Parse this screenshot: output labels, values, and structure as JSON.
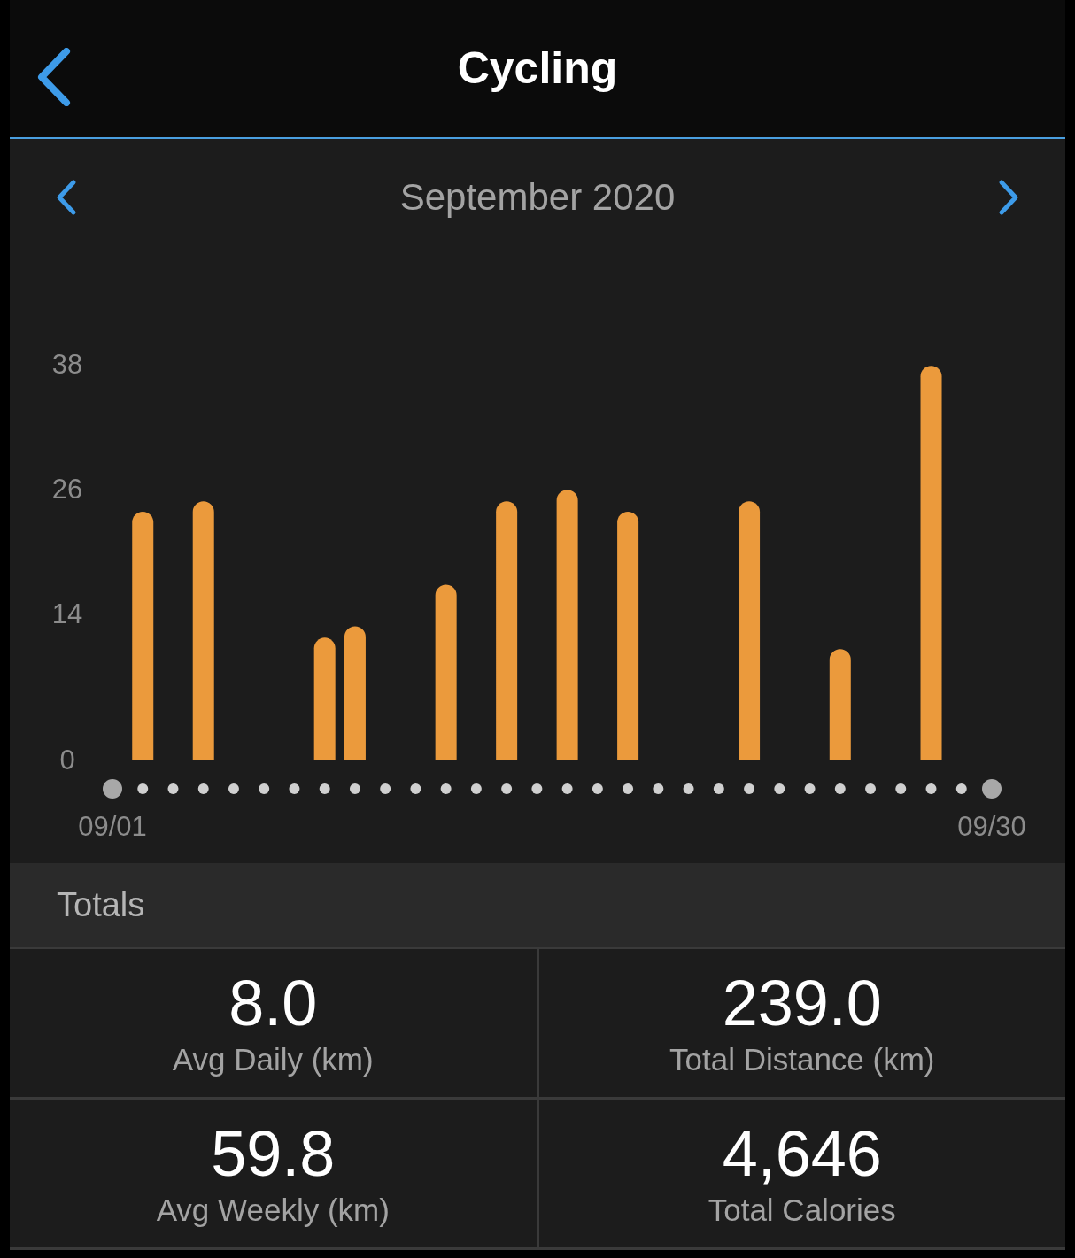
{
  "header": {
    "title": "Cycling"
  },
  "period": {
    "label": "September 2020"
  },
  "chart_data": {
    "type": "bar",
    "categories": [
      "09/01",
      null,
      null,
      null,
      null,
      null,
      null,
      null,
      null,
      null,
      null,
      null,
      null,
      null,
      null,
      null,
      null,
      null,
      null,
      null,
      null,
      null,
      null,
      null,
      null,
      null,
      null,
      null,
      null,
      "09/30"
    ],
    "series": [
      {
        "color": "#eb9a3c",
        "values": [
          null,
          23.8,
          null,
          24.8,
          null,
          null,
          null,
          11.7,
          12.8,
          null,
          null,
          16.8,
          null,
          24.8,
          null,
          25.9,
          null,
          23.8,
          null,
          null,
          null,
          24.8,
          null,
          null,
          10.6,
          null,
          null,
          37.8,
          null,
          null
        ]
      }
    ],
    "ylim": [
      0,
      38
    ],
    "yticks": [
      0,
      14,
      26,
      38
    ]
  },
  "totals": {
    "title": "Totals",
    "stats": [
      {
        "value": "8.0",
        "label": "Avg Daily (km)"
      },
      {
        "value": "239.0",
        "label": "Total Distance (km)"
      },
      {
        "value": "59.8",
        "label": "Avg Weekly (km)"
      },
      {
        "value": "4,646",
        "label": "Total Calories"
      }
    ]
  }
}
